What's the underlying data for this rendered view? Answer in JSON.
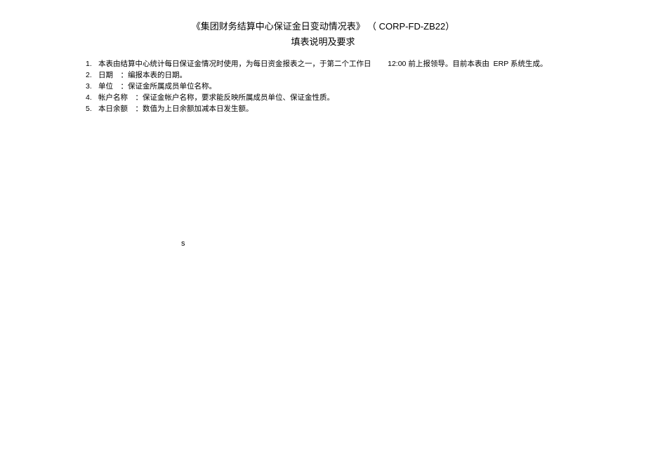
{
  "title": {
    "line1_pre": "《集团财务结算中心保证金日变动情况表》 （",
    "code": " CORP-FD-ZB22",
    "line1_post": "）",
    "line2": "填表说明及要求"
  },
  "items": [
    {
      "num": "1.",
      "parts": {
        "a": "本表由结算中心统计每日保证金情况时使用，为每日资金报表之一，于第二个工作日",
        "gap": "         ",
        "b": "12:00 ",
        "c": "前上报领导。目前本表由",
        "d": "  ERP ",
        "e": "系统生成。"
      }
    },
    {
      "num": "2.",
      "parts": {
        "a": "日期    ：编报本表的日期。"
      }
    },
    {
      "num": "3.",
      "parts": {
        "a": "单位    ：保证金所属成员单位名称。"
      }
    },
    {
      "num": "4.",
      "parts": {
        "a": "帐户名称    ：保证金帐户名称，要求能反映所属成员单位、保证金性质。"
      }
    },
    {
      "num": "5.",
      "parts": {
        "a": "本日余额    ：数值为上日余额加减本日发生额。"
      }
    }
  ],
  "stray": "s"
}
